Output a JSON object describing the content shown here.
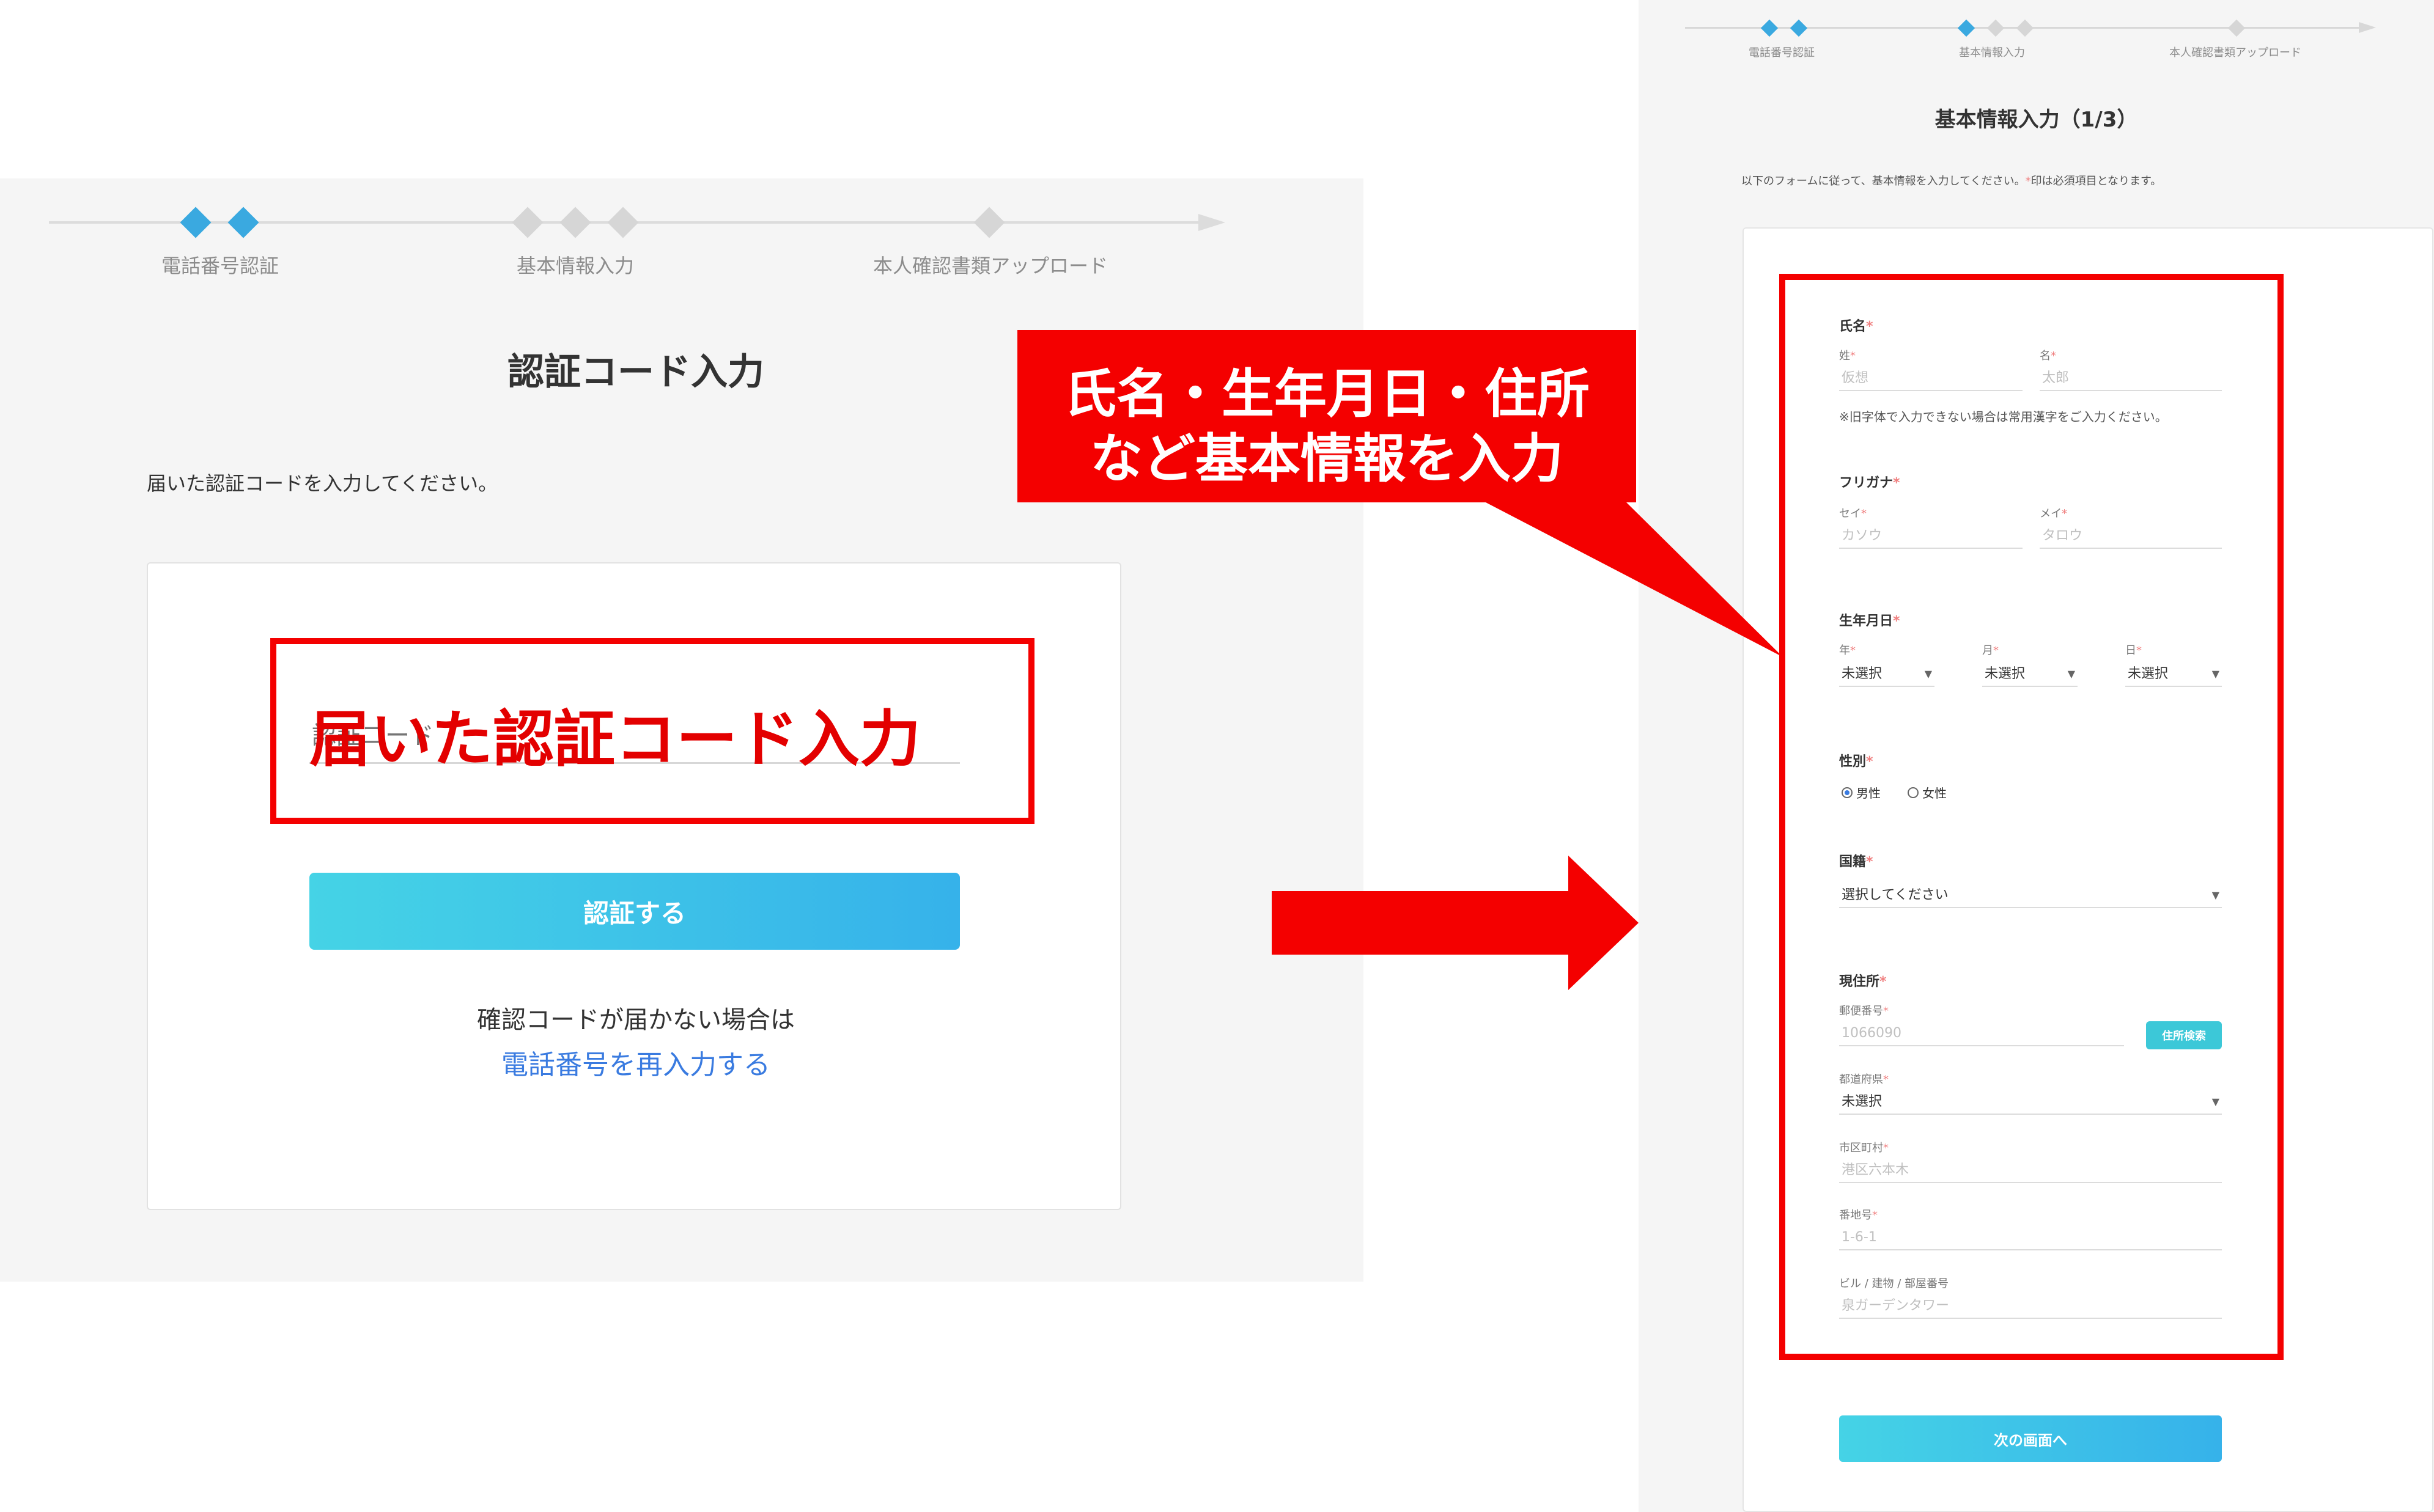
{
  "left_screen": {
    "steps": [
      "電話番号認証",
      "基本情報入力",
      "本人確認書類アップロード"
    ],
    "title": "認証コード入力",
    "instruction": "届いた認証コードを入力してください。",
    "code_input_placeholder": "認証コード",
    "overlay_label": "届いた認証コード入力",
    "verify_button": "認証する",
    "not_received_text": "確認コードが届かない場合は",
    "reenter_link": "電話番号を再入力する"
  },
  "callout": {
    "line1": "氏名・生年月日・住所",
    "line2": "など基本情報を入力"
  },
  "right_screen": {
    "steps": [
      "電話番号認証",
      "基本情報入力",
      "本人確認書類アップロード"
    ],
    "title": "基本情報入力（1/3）",
    "instruction": "以下のフォームに従って、基本情報を入力してください。",
    "instruction_required_mark": "*",
    "instruction_suffix": "印は必須項目となります。",
    "required_mark": "*",
    "name": {
      "section": "氏名",
      "last_label": "姓",
      "last_placeholder": "仮想",
      "first_label": "名",
      "first_placeholder": "太郎",
      "note": "※旧字体で入力できない場合は常用漢字をご入力ください。"
    },
    "furigana": {
      "section": "フリガナ",
      "last_label": "セイ",
      "last_placeholder": "カソウ",
      "first_label": "メイ",
      "first_placeholder": "タロウ"
    },
    "birthdate": {
      "section": "生年月日",
      "year_label": "年",
      "month_label": "月",
      "day_label": "日",
      "year_value": "未選択",
      "month_value": "未選択",
      "day_value": "未選択"
    },
    "gender": {
      "section": "性別",
      "options": [
        "男性",
        "女性"
      ],
      "selected": "男性"
    },
    "nationality": {
      "section": "国籍",
      "value": "選択してください"
    },
    "address": {
      "section": "現住所",
      "zip_label": "郵便番号",
      "zip_placeholder": "1066090",
      "zip_search_button": "住所検索",
      "prefecture_label": "都道府県",
      "prefecture_value": "未選択",
      "city_label": "市区町村",
      "city_placeholder": "港区六本木",
      "street_label": "番地号",
      "street_placeholder": "1-6-1",
      "building_label": "ビル / 建物 / 部屋番号",
      "building_placeholder": "泉ガーデンタワー"
    },
    "next_button": "次の画面へ"
  },
  "colors": {
    "accent_blue": "#3aa9e0",
    "highlight_red": "#f40000",
    "link_blue": "#3a7be0"
  }
}
